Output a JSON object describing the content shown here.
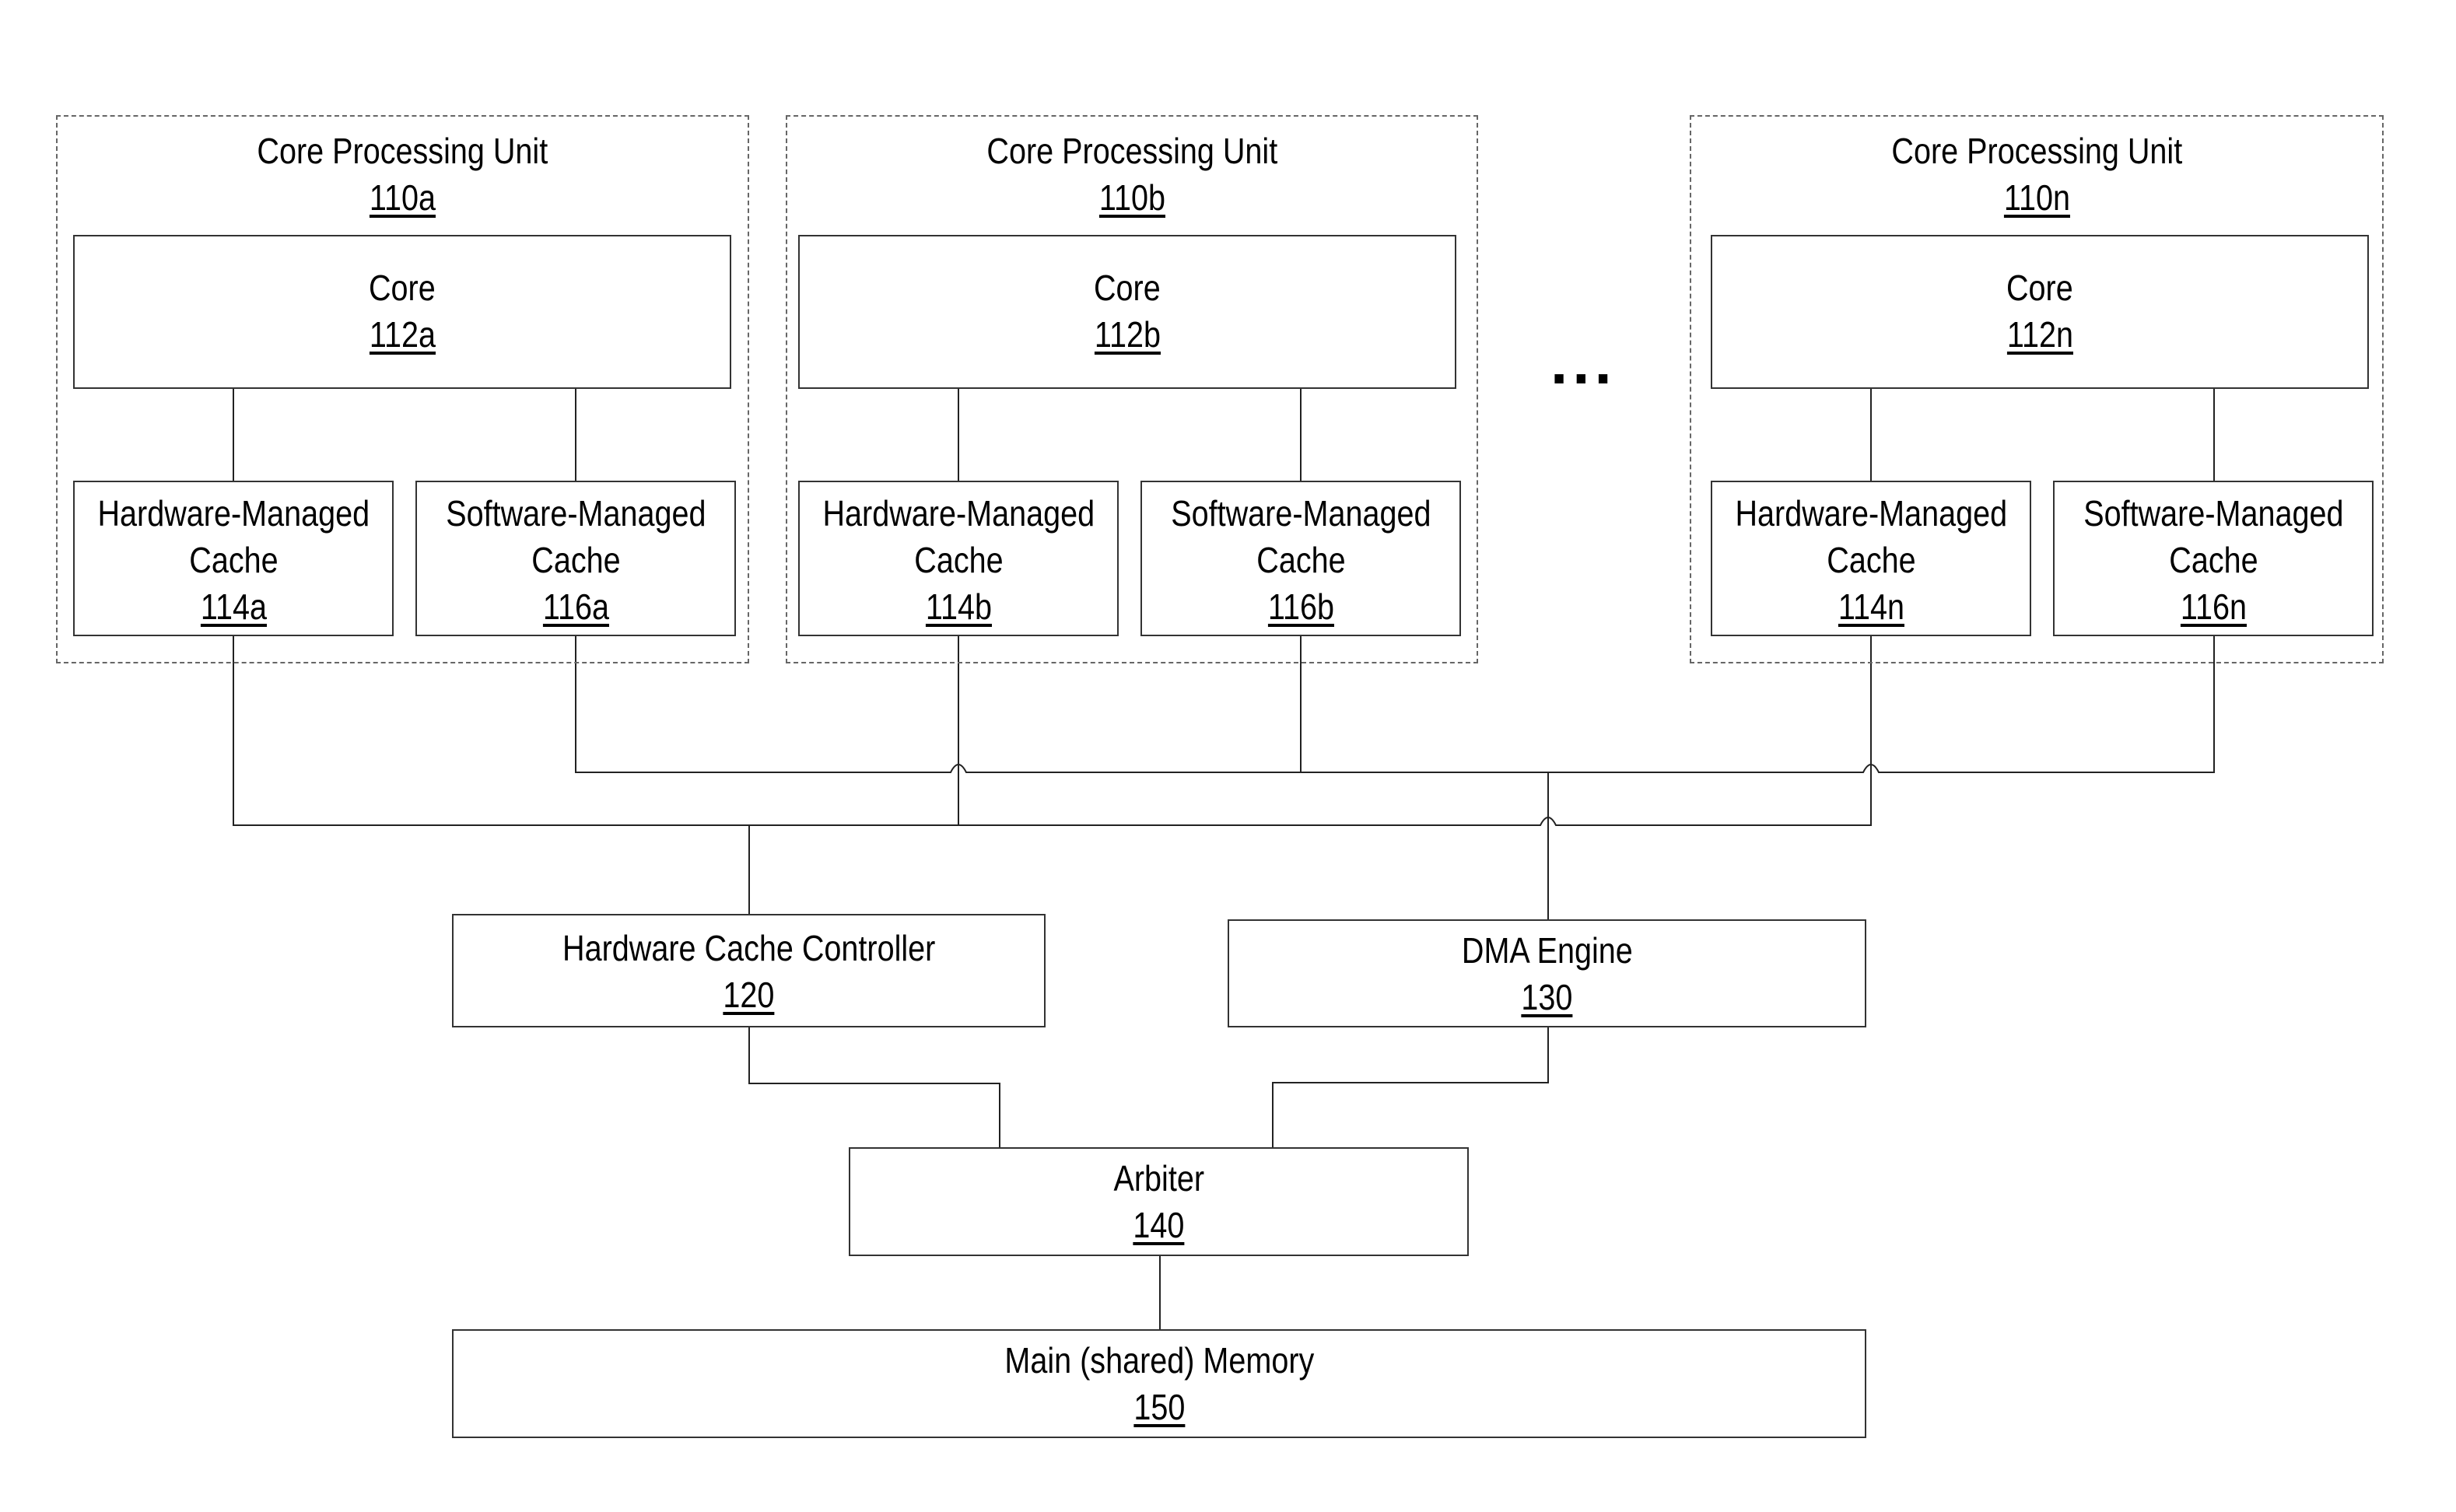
{
  "cpus": [
    {
      "title": "Core Processing Unit",
      "ref": "110a",
      "core": {
        "label": "Core",
        "ref": "112a"
      },
      "hw_cache": {
        "label1": "Hardware-Managed",
        "label2": "Cache",
        "ref": "114a"
      },
      "sw_cache": {
        "label1": "Software-Managed",
        "label2": "Cache",
        "ref": "116a"
      }
    },
    {
      "title": "Core Processing Unit",
      "ref": "110b",
      "core": {
        "label": "Core",
        "ref": "112b"
      },
      "hw_cache": {
        "label1": "Hardware-Managed",
        "label2": "Cache",
        "ref": "114b"
      },
      "sw_cache": {
        "label1": "Software-Managed",
        "label2": "Cache",
        "ref": "116b"
      }
    },
    {
      "title": "Core Processing Unit",
      "ref": "110n",
      "core": {
        "label": "Core",
        "ref": "112n"
      },
      "hw_cache": {
        "label1": "Hardware-Managed",
        "label2": "Cache",
        "ref": "114n"
      },
      "sw_cache": {
        "label1": "Software-Managed",
        "label2": "Cache",
        "ref": "116n"
      }
    }
  ],
  "ellipsis": "...",
  "hw_cache_controller": {
    "label": "Hardware Cache Controller",
    "ref": "120"
  },
  "dma_engine": {
    "label": "DMA Engine",
    "ref": "130"
  },
  "arbiter": {
    "label": "Arbiter",
    "ref": "140"
  },
  "main_memory": {
    "label": "Main (shared) Memory",
    "ref": "150"
  }
}
